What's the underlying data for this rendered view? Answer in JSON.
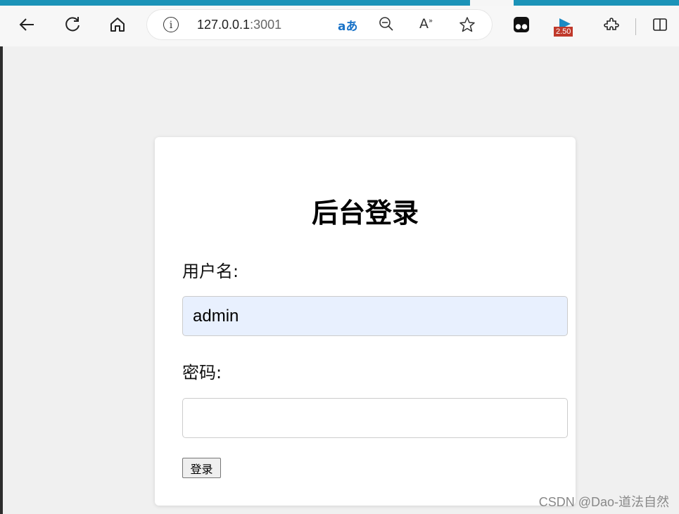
{
  "browser": {
    "url_host": "127.0.0.1",
    "url_port": ":3001",
    "extension_badge": "2.50",
    "icons": {
      "back": "arrow-left",
      "reload": "reload",
      "home": "home",
      "info": "info",
      "translate": "translate",
      "zoom": "zoom-out",
      "read_aloud": "read-aloud",
      "favorite": "star",
      "extension1": "tampermonkey",
      "extension2": "play-badge",
      "extensions": "puzzle",
      "split": "split-screen"
    },
    "accent_color": "#1b93b8"
  },
  "login": {
    "title": "后台登录",
    "username_label": "用户名:",
    "username_value": "admin",
    "password_label": "密码:",
    "password_value": "",
    "submit_label": "登录"
  },
  "watermark": "CSDN @Dao-道法自然"
}
